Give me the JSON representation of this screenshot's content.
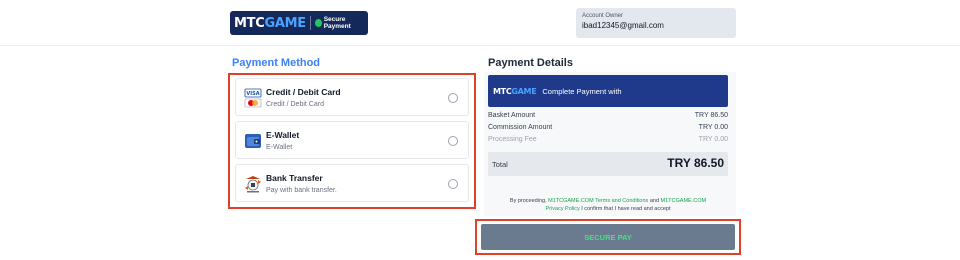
{
  "header": {
    "logo_part1": "MTC",
    "logo_part2": "GAME",
    "badge": "Secure Payment",
    "account_label": "Account Owner",
    "account_email": "ibad12345@gmail.com"
  },
  "payment_method": {
    "title": "Payment Method",
    "items": [
      {
        "title": "Credit / Debit Card",
        "subtitle": "Credit / Debit Card",
        "icon": "credit-card-icon"
      },
      {
        "title": "E-Wallet",
        "subtitle": "E-Wallet",
        "icon": "wallet-icon"
      },
      {
        "title": "Bank Transfer",
        "subtitle": "Pay with bank transfer.",
        "icon": "bank-transfer-icon"
      }
    ]
  },
  "payment_details": {
    "title": "Payment Details",
    "banner_logo1": "MTC",
    "banner_logo2": "GAME",
    "banner_text": "Complete Payment with",
    "basket_label": "Basket Amount",
    "basket_value": "TRY 86.50",
    "commission_label": "Commission Amount",
    "commission_value": "TRY 0.00",
    "processing_label": "Processing Fee",
    "processing_value": "TRY 0.00",
    "total_label": "Total",
    "total_value": "TRY 86.50",
    "terms_1": "By proceeding,",
    "terms_link1": "M1TCGAME.COM Terms and Conditions",
    "terms_2": "and",
    "terms_link2": "M1TCGAME.COM",
    "terms_link3": "Privacy Policy",
    "terms_3": "I confirm that I have read and accept"
  },
  "pay_button": "SECURE PAY",
  "colors": {
    "brand": "#15285a",
    "accent": "#3b82f6",
    "highlight": "#e0402a",
    "pay_text": "#4ade80"
  }
}
